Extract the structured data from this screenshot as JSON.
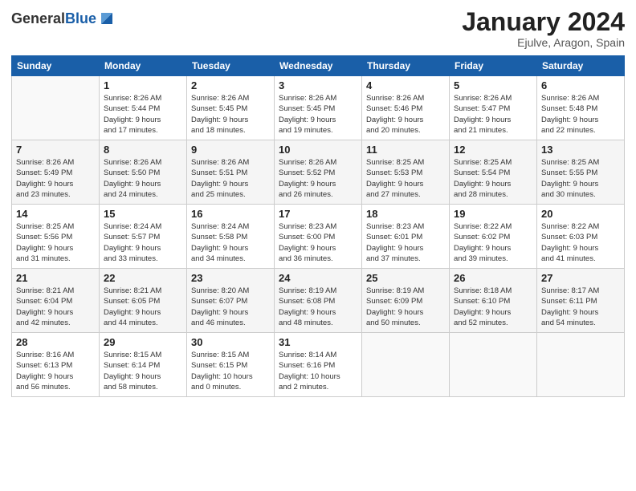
{
  "header": {
    "logo_general": "General",
    "logo_blue": "Blue",
    "month_title": "January 2024",
    "location": "Ejulve, Aragon, Spain"
  },
  "days_of_week": [
    "Sunday",
    "Monday",
    "Tuesday",
    "Wednesday",
    "Thursday",
    "Friday",
    "Saturday"
  ],
  "weeks": [
    [
      {
        "day": "",
        "info": ""
      },
      {
        "day": "1",
        "info": "Sunrise: 8:26 AM\nSunset: 5:44 PM\nDaylight: 9 hours\nand 17 minutes."
      },
      {
        "day": "2",
        "info": "Sunrise: 8:26 AM\nSunset: 5:45 PM\nDaylight: 9 hours\nand 18 minutes."
      },
      {
        "day": "3",
        "info": "Sunrise: 8:26 AM\nSunset: 5:45 PM\nDaylight: 9 hours\nand 19 minutes."
      },
      {
        "day": "4",
        "info": "Sunrise: 8:26 AM\nSunset: 5:46 PM\nDaylight: 9 hours\nand 20 minutes."
      },
      {
        "day": "5",
        "info": "Sunrise: 8:26 AM\nSunset: 5:47 PM\nDaylight: 9 hours\nand 21 minutes."
      },
      {
        "day": "6",
        "info": "Sunrise: 8:26 AM\nSunset: 5:48 PM\nDaylight: 9 hours\nand 22 minutes."
      }
    ],
    [
      {
        "day": "7",
        "info": "Sunrise: 8:26 AM\nSunset: 5:49 PM\nDaylight: 9 hours\nand 23 minutes."
      },
      {
        "day": "8",
        "info": "Sunrise: 8:26 AM\nSunset: 5:50 PM\nDaylight: 9 hours\nand 24 minutes."
      },
      {
        "day": "9",
        "info": "Sunrise: 8:26 AM\nSunset: 5:51 PM\nDaylight: 9 hours\nand 25 minutes."
      },
      {
        "day": "10",
        "info": "Sunrise: 8:26 AM\nSunset: 5:52 PM\nDaylight: 9 hours\nand 26 minutes."
      },
      {
        "day": "11",
        "info": "Sunrise: 8:25 AM\nSunset: 5:53 PM\nDaylight: 9 hours\nand 27 minutes."
      },
      {
        "day": "12",
        "info": "Sunrise: 8:25 AM\nSunset: 5:54 PM\nDaylight: 9 hours\nand 28 minutes."
      },
      {
        "day": "13",
        "info": "Sunrise: 8:25 AM\nSunset: 5:55 PM\nDaylight: 9 hours\nand 30 minutes."
      }
    ],
    [
      {
        "day": "14",
        "info": "Sunrise: 8:25 AM\nSunset: 5:56 PM\nDaylight: 9 hours\nand 31 minutes."
      },
      {
        "day": "15",
        "info": "Sunrise: 8:24 AM\nSunset: 5:57 PM\nDaylight: 9 hours\nand 33 minutes."
      },
      {
        "day": "16",
        "info": "Sunrise: 8:24 AM\nSunset: 5:58 PM\nDaylight: 9 hours\nand 34 minutes."
      },
      {
        "day": "17",
        "info": "Sunrise: 8:23 AM\nSunset: 6:00 PM\nDaylight: 9 hours\nand 36 minutes."
      },
      {
        "day": "18",
        "info": "Sunrise: 8:23 AM\nSunset: 6:01 PM\nDaylight: 9 hours\nand 37 minutes."
      },
      {
        "day": "19",
        "info": "Sunrise: 8:22 AM\nSunset: 6:02 PM\nDaylight: 9 hours\nand 39 minutes."
      },
      {
        "day": "20",
        "info": "Sunrise: 8:22 AM\nSunset: 6:03 PM\nDaylight: 9 hours\nand 41 minutes."
      }
    ],
    [
      {
        "day": "21",
        "info": "Sunrise: 8:21 AM\nSunset: 6:04 PM\nDaylight: 9 hours\nand 42 minutes."
      },
      {
        "day": "22",
        "info": "Sunrise: 8:21 AM\nSunset: 6:05 PM\nDaylight: 9 hours\nand 44 minutes."
      },
      {
        "day": "23",
        "info": "Sunrise: 8:20 AM\nSunset: 6:07 PM\nDaylight: 9 hours\nand 46 minutes."
      },
      {
        "day": "24",
        "info": "Sunrise: 8:19 AM\nSunset: 6:08 PM\nDaylight: 9 hours\nand 48 minutes."
      },
      {
        "day": "25",
        "info": "Sunrise: 8:19 AM\nSunset: 6:09 PM\nDaylight: 9 hours\nand 50 minutes."
      },
      {
        "day": "26",
        "info": "Sunrise: 8:18 AM\nSunset: 6:10 PM\nDaylight: 9 hours\nand 52 minutes."
      },
      {
        "day": "27",
        "info": "Sunrise: 8:17 AM\nSunset: 6:11 PM\nDaylight: 9 hours\nand 54 minutes."
      }
    ],
    [
      {
        "day": "28",
        "info": "Sunrise: 8:16 AM\nSunset: 6:13 PM\nDaylight: 9 hours\nand 56 minutes."
      },
      {
        "day": "29",
        "info": "Sunrise: 8:15 AM\nSunset: 6:14 PM\nDaylight: 9 hours\nand 58 minutes."
      },
      {
        "day": "30",
        "info": "Sunrise: 8:15 AM\nSunset: 6:15 PM\nDaylight: 10 hours\nand 0 minutes."
      },
      {
        "day": "31",
        "info": "Sunrise: 8:14 AM\nSunset: 6:16 PM\nDaylight: 10 hours\nand 2 minutes."
      },
      {
        "day": "",
        "info": ""
      },
      {
        "day": "",
        "info": ""
      },
      {
        "day": "",
        "info": ""
      }
    ]
  ]
}
